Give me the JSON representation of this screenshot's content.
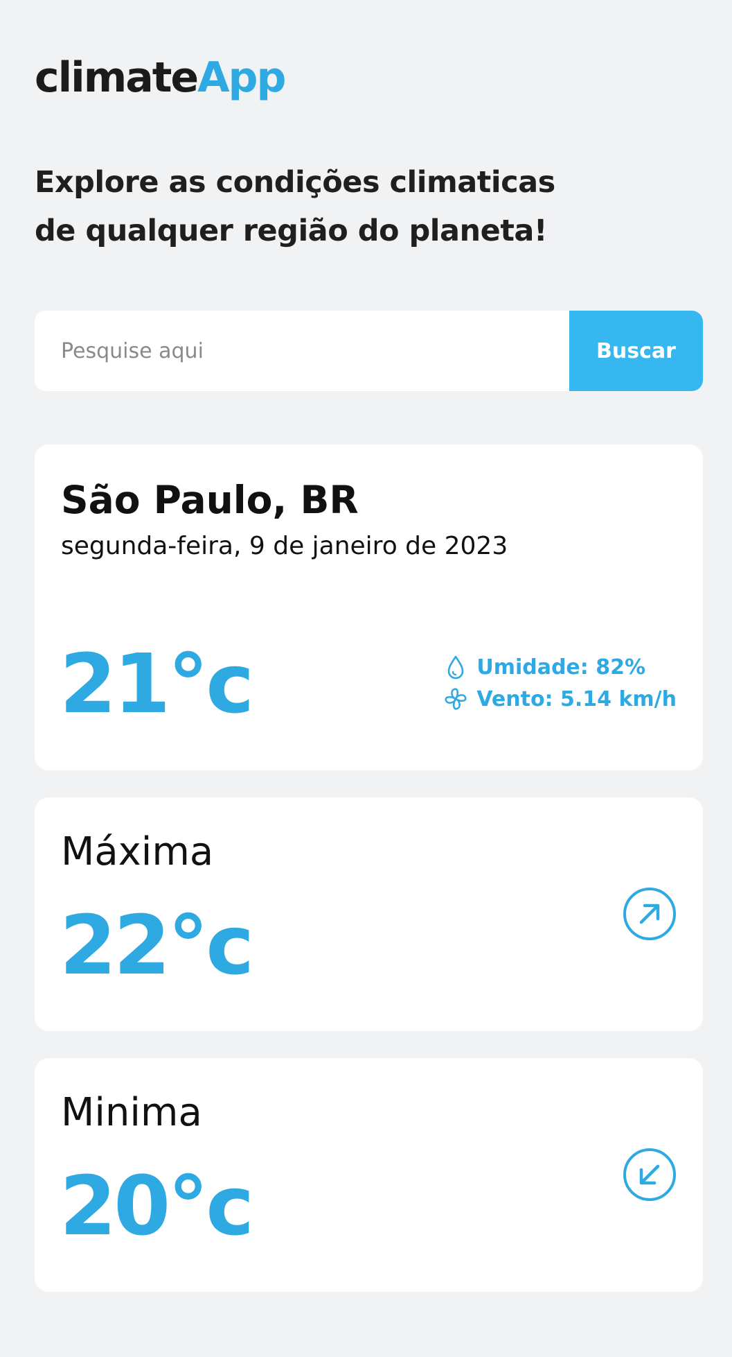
{
  "app": {
    "logo_part1": "climate",
    "logo_part2": "App",
    "accent_color": "#2fa9e2",
    "button_color": "#36b7f0"
  },
  "headline": {
    "line1": "Explore as condições climaticas",
    "line2": "de qualquer região do planeta!"
  },
  "search": {
    "placeholder": "Pesquise aqui",
    "value": "",
    "button_label": "Buscar"
  },
  "current": {
    "city": "São Paulo, BR",
    "date": "segunda-feira, 9 de janeiro de 2023",
    "temperature": "21°c",
    "humidity": "Umidade: 82%",
    "wind": "Vento: 5.14 km/h",
    "humidity_icon": "droplet-icon",
    "wind_icon": "fan-icon"
  },
  "max": {
    "label": "Máxima",
    "temperature": "22°c",
    "icon": "arrow-up-right-icon"
  },
  "min": {
    "label": "Minima",
    "temperature": "20°c",
    "icon": "arrow-down-left-icon"
  }
}
